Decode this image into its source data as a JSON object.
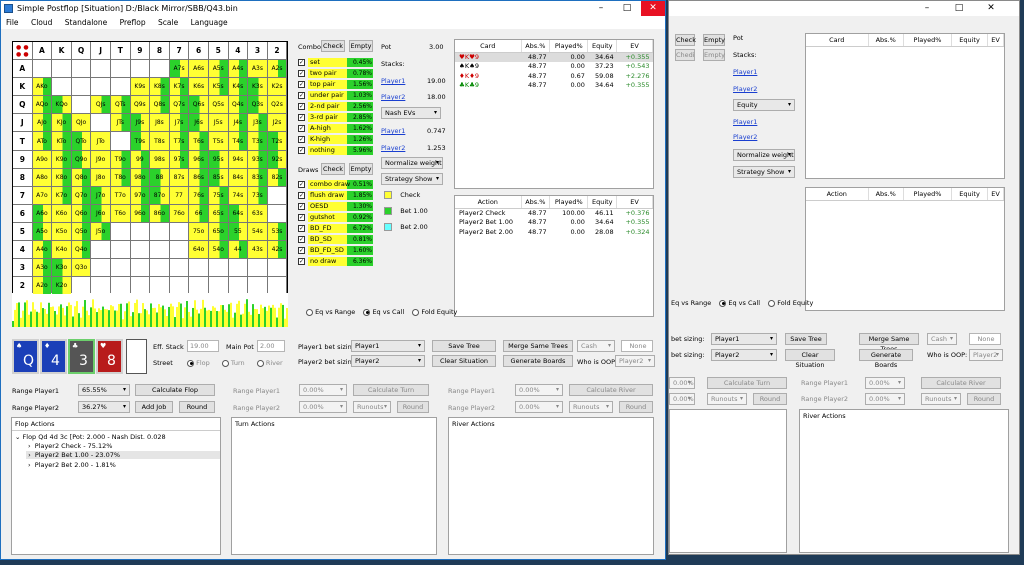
{
  "main_window": {
    "title": "Simple Postflop [Situation] D:/Black Mirror/SBB/Q43.bin",
    "menu": [
      "File",
      "Cloud",
      "Standalone",
      "Preflop",
      "Scale",
      "Language"
    ],
    "window_buttons": [
      "–",
      "□",
      "✕"
    ]
  },
  "grid": {
    "ranks": [
      "A",
      "K",
      "Q",
      "J",
      "T",
      "9",
      "8",
      "7",
      "6",
      "5",
      "4",
      "3",
      "2"
    ],
    "rows": [
      [
        "",
        "",
        "",
        "",
        "",
        "",
        "",
        "A7s",
        "A6s",
        "A5s",
        "A4s",
        "A3s",
        "A2s"
      ],
      [
        "AKo",
        "",
        "",
        "",
        "",
        "K9s",
        "K8s",
        "K7s",
        "K6s",
        "K5s",
        "K4s",
        "K3s",
        "K2s"
      ],
      [
        "AQo",
        "KQo",
        "",
        "QJs",
        "QTs",
        "Q9s",
        "Q8s",
        "Q7s",
        "Q6s",
        "Q5s",
        "Q4s",
        "Q3s",
        "Q2s"
      ],
      [
        "AJo",
        "KJo",
        "QJo",
        "",
        "JTs",
        "J9s",
        "J8s",
        "J7s",
        "J6s",
        "J5s",
        "J4s",
        "J3s",
        "J2s"
      ],
      [
        "ATo",
        "KTo",
        "QTo",
        "JTo",
        "",
        "T9s",
        "T8s",
        "T7s",
        "T6s",
        "T5s",
        "T4s",
        "T3s",
        "T2s"
      ],
      [
        "A9o",
        "K9o",
        "Q9o",
        "J9o",
        "T9o",
        "99",
        "98s",
        "97s",
        "96s",
        "95s",
        "94s",
        "93s",
        "92s"
      ],
      [
        "A8o",
        "K8o",
        "Q8o",
        "J8o",
        "T8o",
        "98o",
        "88",
        "87s",
        "86s",
        "85s",
        "84s",
        "83s",
        "82s"
      ],
      [
        "A7o",
        "K7o",
        "Q7o",
        "J7o",
        "T7o",
        "97o",
        "87o",
        "77",
        "76s",
        "75s",
        "74s",
        "73s",
        ""
      ],
      [
        "A6o",
        "K6o",
        "Q6o",
        "J6o",
        "T6o",
        "96o",
        "86o",
        "76o",
        "66",
        "65s",
        "64s",
        "63s",
        ""
      ],
      [
        "A5o",
        "K5o",
        "Q5o",
        "J5o",
        "",
        "",
        "",
        "",
        "75o",
        "65o",
        "55",
        "54s",
        "53s"
      ],
      [
        "A4o",
        "K4o",
        "Q4o",
        "",
        "",
        "",
        "",
        "",
        "64o",
        "54o",
        "44",
        "43s",
        "42s"
      ],
      [
        "A3o",
        "K3o",
        "Q3o",
        "",
        "",
        "",
        "",
        "",
        "",
        "",
        "",
        "",
        ""
      ],
      [
        "A2o",
        "K2o",
        "",
        "",
        "",
        "",
        "",
        "",
        "",
        "",
        "",
        "",
        ""
      ]
    ]
  },
  "combos": {
    "label": "Combos",
    "check_btn": "Check",
    "empty_btn": "Empty",
    "items": [
      {
        "name": "set",
        "value": "0.45%",
        "frac": 0.02
      },
      {
        "name": "two pair",
        "value": "0.78%",
        "frac": 0.04
      },
      {
        "name": "top pair",
        "value": "1.56%",
        "frac": 0.1
      },
      {
        "name": "under pair",
        "value": "1.03%",
        "frac": 0.06
      },
      {
        "name": "2-nd pair",
        "value": "2.56%",
        "frac": 0.16
      },
      {
        "name": "3-rd pair",
        "value": "2.85%",
        "frac": 0.18
      },
      {
        "name": "A-high",
        "value": "1.62%",
        "frac": 0.1
      },
      {
        "name": "K-high",
        "value": "1.26%",
        "frac": 0.08
      },
      {
        "name": "nothing",
        "value": "5.96%",
        "frac": 0.38
      }
    ]
  },
  "draws": {
    "label": "Draws",
    "check_btn": "Check",
    "empty_btn": "Empty",
    "items": [
      {
        "name": "combo draw",
        "value": "0.51%",
        "frac": 0.03
      },
      {
        "name": "flush draw",
        "value": "1.85%",
        "frac": 0.12
      },
      {
        "name": "OESD",
        "value": "1.30%",
        "frac": 0.08
      },
      {
        "name": "gutshot",
        "value": "0.92%",
        "frac": 0.06
      },
      {
        "name": "BD_FD",
        "value": "6.72%",
        "frac": 0.43
      },
      {
        "name": "BD_SD",
        "value": "0.81%",
        "frac": 0.05
      },
      {
        "name": "BD_FD_SD",
        "value": "1.60%",
        "frac": 0.1
      },
      {
        "name": "no draw",
        "value": "6.36%",
        "frac": 0.41
      }
    ]
  },
  "info": {
    "pot_label": "Pot",
    "pot_value": "3.00",
    "stacks_label": "Stacks:",
    "player1": "Player1",
    "player1_stack": "19.00",
    "player2": "Player2",
    "player2_stack": "18.00",
    "nash_evs": "Nash EVs",
    "player1_ev": "0.747",
    "player2_ev": "1.253",
    "normalize": "Normalize weight",
    "strategy_show": "Strategy Show",
    "legend": [
      {
        "label": "Check",
        "color": "#ffff33"
      },
      {
        "label": "Bet 1.00",
        "color": "#2bd12b"
      },
      {
        "label": "Bet 2.00",
        "color": "#66ffff"
      }
    ]
  },
  "card_table": {
    "headers": [
      "Card",
      "Abs.%",
      "Played%",
      "Equity",
      "EV"
    ],
    "rows": [
      {
        "card": "♥K♥9",
        "abs": "48.77",
        "played": "0.00",
        "equity": "34.64",
        "ev": "+0.355"
      },
      {
        "card": "♠K♠9",
        "abs": "48.77",
        "played": "0.00",
        "equity": "37.23",
        "ev": "+0.543"
      },
      {
        "card": "♦K♦9",
        "abs": "48.77",
        "played": "0.67",
        "equity": "59.08",
        "ev": "+2.276"
      },
      {
        "card": "♣K♣9",
        "abs": "48.77",
        "played": "0.00",
        "equity": "34.64",
        "ev": "+0.355"
      }
    ]
  },
  "action_table": {
    "headers": [
      "Action",
      "Abs.%",
      "Played%",
      "Equity",
      "EV"
    ],
    "rows": [
      {
        "action": "Player2 Check",
        "abs": "48.77",
        "played": "100.00",
        "equity": "46.11",
        "ev": "+0.376"
      },
      {
        "action": "Player2 Bet 1.00",
        "abs": "48.77",
        "played": "0.00",
        "equity": "34.64",
        "ev": "+0.355"
      },
      {
        "action": "Player2 Bet 2.00",
        "abs": "48.77",
        "played": "0.00",
        "equity": "28.08",
        "ev": "+0.324"
      }
    ]
  },
  "eq_modes": {
    "options": [
      "Eq vs Range",
      "Eq vs Call",
      "Fold Equity"
    ],
    "selected": 1
  },
  "board": {
    "cards": [
      {
        "rank": "Q",
        "suit": "♠",
        "color": "#1b3fb8"
      },
      {
        "rank": "4",
        "suit": "♦",
        "color": "#1b3fb8"
      },
      {
        "rank": "3",
        "suit": "♣",
        "color": "#555555"
      },
      {
        "rank": "8",
        "suit": "♥",
        "color": "#b81b1b"
      }
    ]
  },
  "controls": {
    "eff_stack_label": "Eff. Stack",
    "eff_stack": "19.00",
    "main_pot_label": "Main Pot",
    "main_pot": "2.00",
    "street_label": "Street",
    "streets": [
      "Flop",
      "Turn",
      "River"
    ],
    "p1_bet_sizing_label": "Player1 bet sizing:",
    "p1_bet_sizing": "Player1",
    "p2_bet_sizing_label": "Player2 bet sizing:",
    "p2_bet_sizing": "Player2",
    "save_tree": "Save Tree",
    "clear_situation": "Clear Situation",
    "merge_trees": "Merge Same Trees",
    "generate_boards": "Generate Boards",
    "cash": "Cash",
    "none": "None",
    "who_is_oop": "Who is OOP:",
    "oop_value": "Player2",
    "range_player1_label": "Range Player1",
    "range_player1": "65.55%",
    "range_player2_label": "Range Player2",
    "range_player2": "36.27%",
    "calc_flop": "Calculate Flop",
    "add_job": "Add Job",
    "round": "Round",
    "turn_range1": "0.00%",
    "turn_range2": "0.00%",
    "calc_turn": "Calculate Turn",
    "runouts": "Runouts",
    "calc_river": "Calculate River"
  },
  "actions": {
    "flop_title": "Flop Actions",
    "turn_title": "Turn Actions",
    "river_title": "River Actions",
    "root": "Flop Qd 4d 3c [Pot: 2.000 - Nash Dist. 0.028",
    "children": [
      "Player2 Check - 75.12%",
      "Player2 Bet 1.00 - 23.07%",
      "Player2 Bet 2.00 - 1.81%"
    ]
  },
  "second_window": {
    "check": "Check",
    "empty": "Empty",
    "pot": "Pot",
    "stacks": "Stacks:",
    "player1": "Player1",
    "player2": "Player2",
    "equity": "Equity",
    "normalize": "Normalize weight",
    "strategy_show": "Strategy Show",
    "card_headers": [
      "Card",
      "Abs.%",
      "Played%",
      "Equity",
      "EV"
    ],
    "action_headers": [
      "Action",
      "Abs.%",
      "Played%",
      "Equity",
      "EV"
    ],
    "eq_modes": [
      "Eq vs Range",
      "Eq vs Call",
      "Fold Equity"
    ],
    "bet_sizing": "bet sizing:",
    "player1_sel": "Player1",
    "player2_sel": "Player2",
    "save_tree": "Save Tree",
    "merge_trees": "Merge Same Trees",
    "clear_situation": "Clear Situation",
    "generate_boards": "Generate Boards",
    "cash": "Cash",
    "none": "None",
    "who_is_oop": "Who is OOP:",
    "oop_value": "Player2",
    "pct": "0.00%",
    "calc_turn": "Calculate Turn",
    "calc_river": "Calculate River",
    "range_player1": "Range Player1",
    "range_player2": "Range Player2",
    "runouts": "Runouts",
    "round": "Round",
    "river_actions": "River Actions"
  }
}
